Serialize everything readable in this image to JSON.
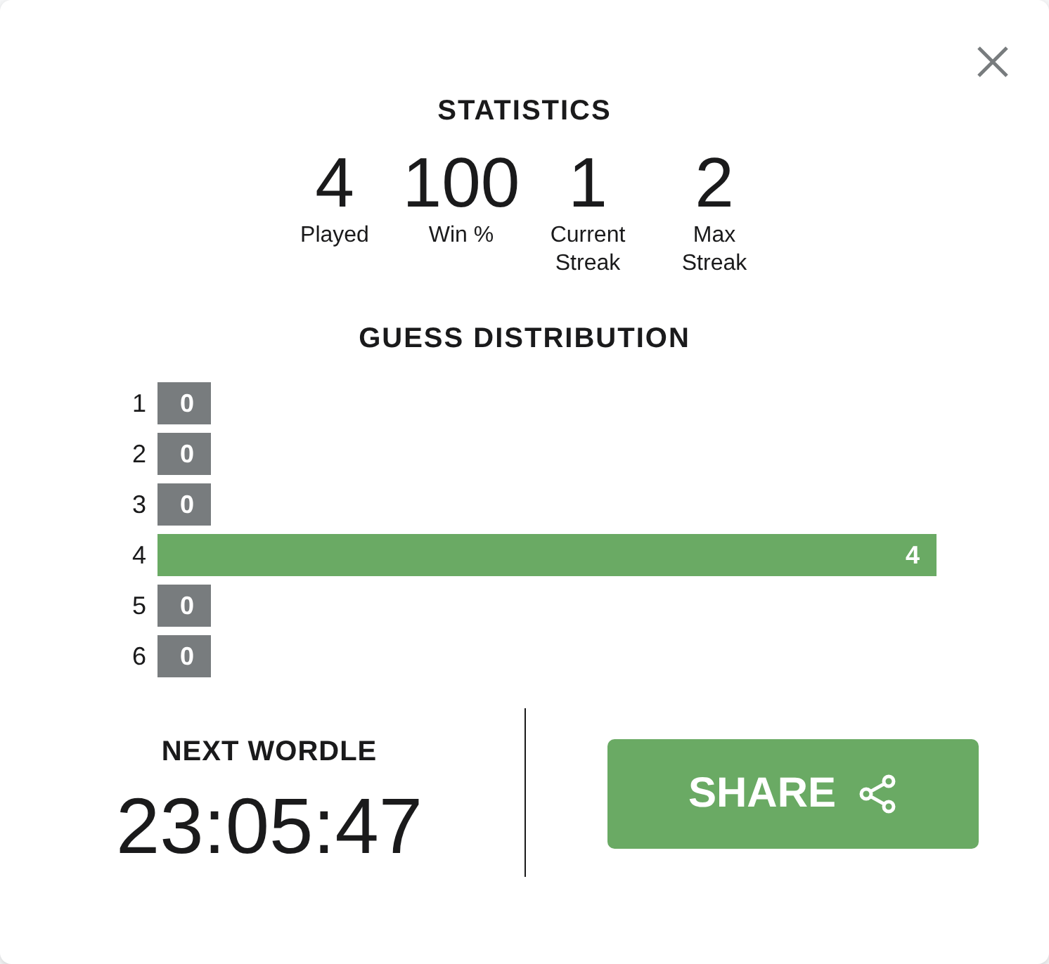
{
  "title": "STATISTICS",
  "stats": [
    {
      "value": "4",
      "label": "Played"
    },
    {
      "value": "100",
      "label": "Win %"
    },
    {
      "value": "1",
      "label": "Current Streak"
    },
    {
      "value": "2",
      "label": "Max Streak"
    }
  ],
  "distribution_title": "GUESS DISTRIBUTION",
  "distribution": [
    {
      "guess": "1",
      "count": "0",
      "selected": false
    },
    {
      "guess": "2",
      "count": "0",
      "selected": false
    },
    {
      "guess": "3",
      "count": "0",
      "selected": false
    },
    {
      "guess": "4",
      "count": "4",
      "selected": true
    },
    {
      "guess": "5",
      "count": "0",
      "selected": false
    },
    {
      "guess": "6",
      "count": "0",
      "selected": false
    }
  ],
  "countdown": {
    "label": "NEXT WORDLE",
    "time": "23:05:47"
  },
  "share_button": "SHARE"
}
